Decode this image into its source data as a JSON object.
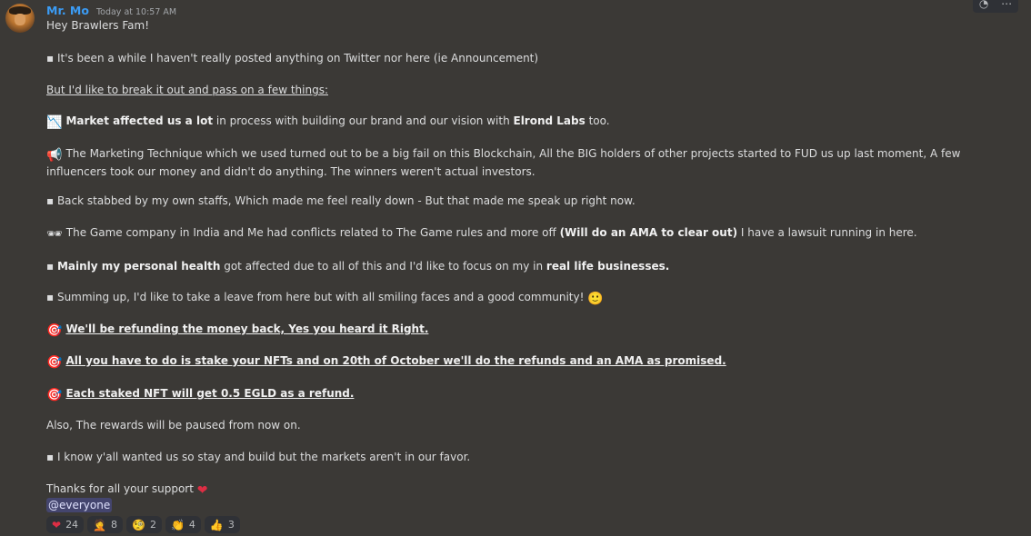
{
  "author": "Mr. Mo",
  "timestamp": "Today at 10:57 AM",
  "lines": {
    "greeting": "Hey Brawlers Fam!",
    "l1": "▪ It's been a while I haven't really posted anything on Twitter nor here (ie Announcement)",
    "l2": "But I'd like to break it out and pass on a few things:",
    "l3_bold1": "Market affected us a lot",
    "l3_text": " in process with building our brand and our vision with ",
    "l3_bold2": "Elrond Labs",
    "l3_end": " too.",
    "l4": "The Marketing Technique which we used turned out to be a big fail on this Blockchain, All the BIG holders of other projects started to FUD us up last moment, A few influencers took our money and didn't do anything. The winners weren't actual investors.",
    "l5": "▪ Back stabbed by my own staffs, Which made me feel really down - But that made me speak up right now.",
    "l6_text": "The Game company in India and Me had conflicts related to The Game rules and more off ",
    "l6_bold": "(Will do an AMA to clear out)",
    "l6_end": " I have a lawsuit running in here.",
    "l7_prefix": "▪ ",
    "l7_bold1": "Mainly my personal health",
    "l7_text": " got affected due to all of this and I'd like to focus on my in ",
    "l7_bold2": "real life businesses.",
    "l8": "▪ Summing up, I'd like to take a leave from here but with all smiling faces and a good community!",
    "l9": "We'll be refunding the money back, Yes you heard it Right.",
    "l10": "All you have to do is stake your NFTs and on 20th of October we'll do the refunds and an AMA as promised.",
    "l11": "Each staked NFT will get 0.5 EGLD as a refund.",
    "l12": "Also, The rewards will be paused from now on.",
    "l13": "▪ I know y'all wanted us so stay and build but the markets aren't in our favor.",
    "l14": "Thanks for all your support",
    "mention": "@everyone"
  },
  "emojis": {
    "chart_down": "📉",
    "megaphone": "📢",
    "glasses": "🕶",
    "smile": "🙂",
    "target": "🎯",
    "heart": "❤"
  },
  "reactions": [
    {
      "emoji": "❤",
      "count": "24"
    },
    {
      "emoji": "🤦",
      "count": "8"
    },
    {
      "emoji": "🧐",
      "count": "2"
    },
    {
      "emoji": "👏",
      "count": "4"
    },
    {
      "emoji": "👍",
      "count": "3"
    }
  ],
  "toolbar": {
    "icon1": "◔",
    "icon2": "⋯"
  }
}
